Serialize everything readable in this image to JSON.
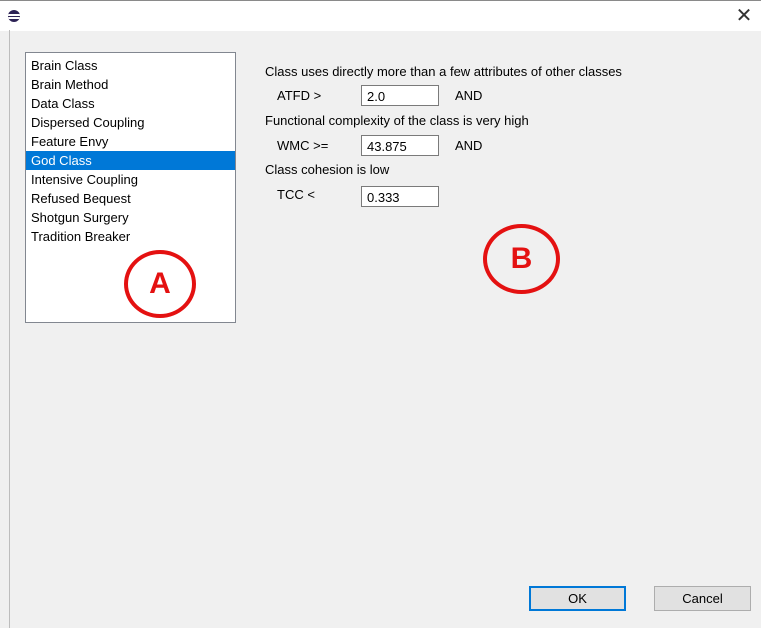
{
  "window": {
    "close_glyph": "✕"
  },
  "rule_list": {
    "selected_index": 5,
    "items": [
      "Brain Class",
      "Brain Method",
      "Data Class",
      "Dispersed Coupling",
      "Feature Envy",
      "God Class",
      "Intensive Coupling",
      "Refused Bequest",
      "Shotgun Surgery",
      "Tradition Breaker"
    ]
  },
  "annotations": {
    "a": "A",
    "b": "B",
    "color": "#e41111"
  },
  "criteria": {
    "c1_text": "Class uses directly more than a few attributes of other classes",
    "c1_label": "ATFD >",
    "c1_value": "2.0",
    "c1_op": "AND",
    "c2_text": "Functional complexity of the class is very high",
    "c2_label": "WMC >=",
    "c2_value": "43.875",
    "c2_op": "AND",
    "c3_text": "Class cohesion is low",
    "c3_label": "TCC <",
    "c3_value": "0.333"
  },
  "buttons": {
    "ok": "OK",
    "cancel": "Cancel"
  },
  "colors": {
    "selection": "#0078d7",
    "dialog_bg": "#f0f0f0",
    "default_button_border": "#0078d7"
  },
  "icons": {
    "app": "eclipse-icon",
    "close": "close-icon"
  }
}
